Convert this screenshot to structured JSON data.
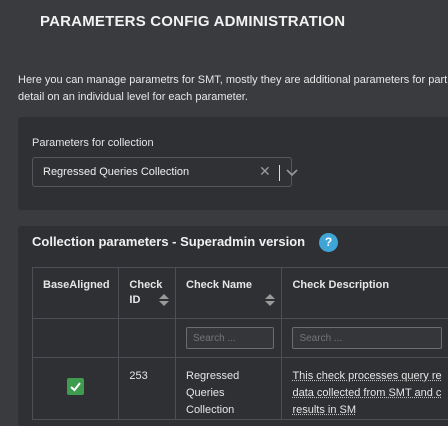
{
  "header": {
    "title": "PARAMETERS CONFIG ADMINISTRATION"
  },
  "intro": {
    "line1": "Here you can manage parametrs for SMT, mostly they are additional parameters for part",
    "line2": "detail on an individual level for each parameter."
  },
  "collection_panel": {
    "label": "Parameters for collection",
    "selected": "Regressed Queries Collection",
    "clear_glyph": "✕"
  },
  "params_panel": {
    "title": "Collection parameters - Superadmin version",
    "help_glyph": "?",
    "columns": {
      "base_aligned": "BaseAligned",
      "check_id_1": "Check",
      "check_id_2": "ID",
      "check_name": "Check Name",
      "check_description": "Check Description"
    },
    "search_placeholder": "Search ...",
    "rows": [
      {
        "base_aligned": true,
        "check_id": "253",
        "check_name_1": "Regressed",
        "check_name_2": "Queries Collection",
        "description_1": "This check processes query re",
        "description_2": "data collected from SMT and c",
        "description_3": "results in SM"
      }
    ]
  },
  "colors": {
    "background": "#3a3b3f",
    "panel": "#2f3034",
    "accent_help": "#3fa4d6",
    "check_green": "#3f9b4f"
  }
}
